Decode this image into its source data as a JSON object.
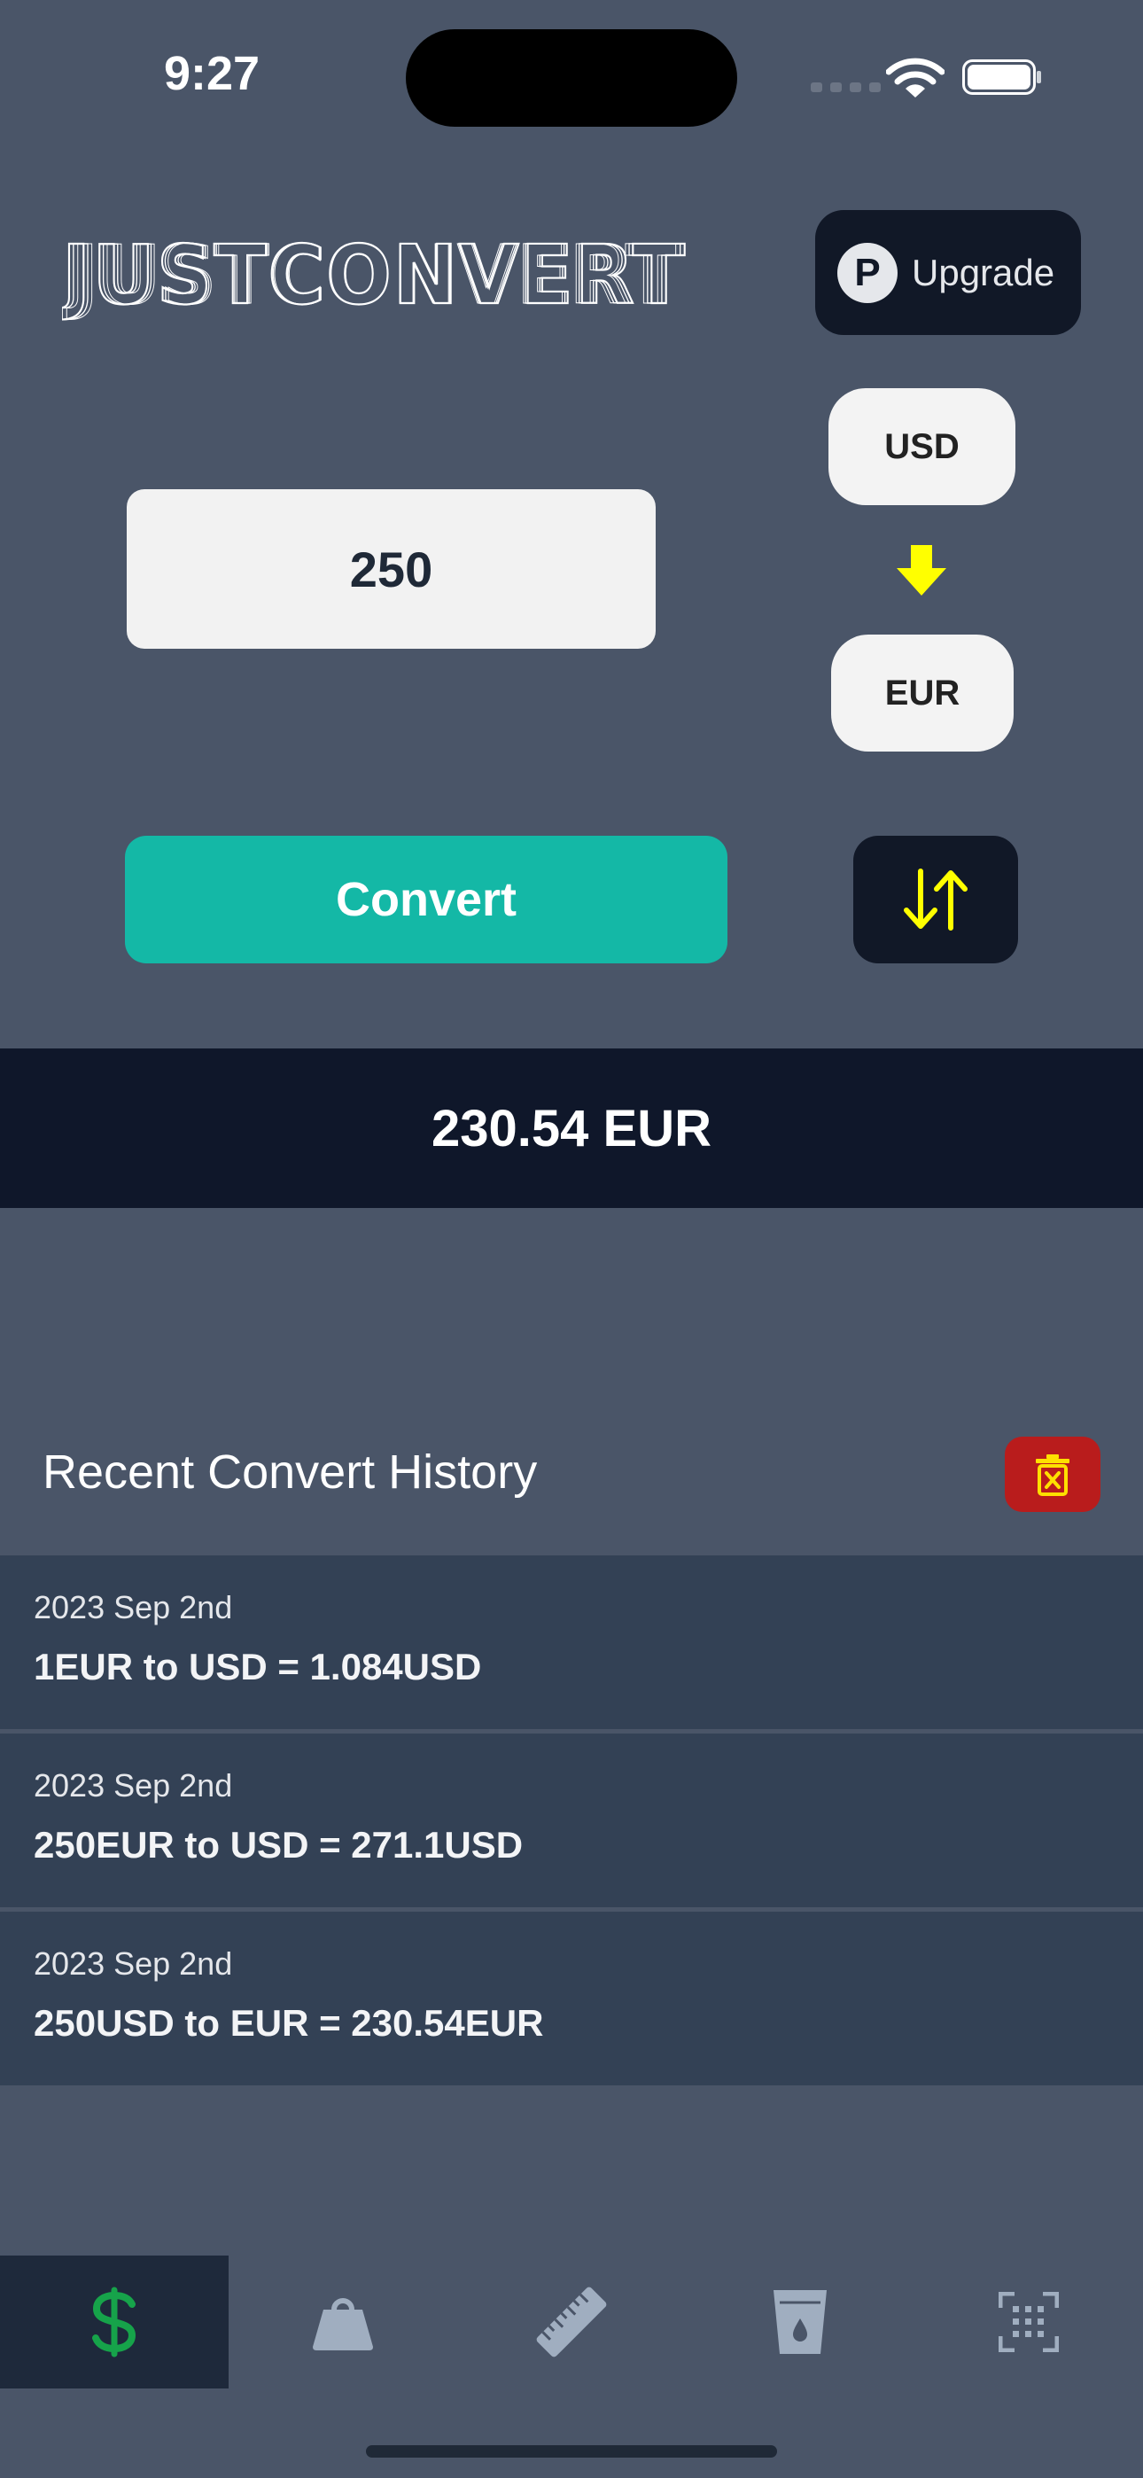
{
  "status_bar": {
    "time": "9:27"
  },
  "header": {
    "logo_text": "JUSTCONVERT",
    "upgrade": {
      "badge": "P",
      "label": "Upgrade"
    }
  },
  "converter": {
    "amount_value": "250",
    "from_currency": "USD",
    "to_currency": "EUR",
    "convert_label": "Convert",
    "result": "230.54 EUR"
  },
  "history": {
    "title": "Recent Convert History",
    "items": [
      {
        "date": "2023 Sep 2nd",
        "desc": "1EUR to USD = 1.084USD"
      },
      {
        "date": "2023 Sep 2nd",
        "desc": "250EUR to USD = 271.1USD"
      },
      {
        "date": "2023 Sep 2nd",
        "desc": "250USD to EUR = 230.54EUR"
      }
    ]
  },
  "tabs": [
    {
      "icon": "dollar-icon",
      "active": true
    },
    {
      "icon": "weight-icon",
      "active": false
    },
    {
      "icon": "ruler-icon",
      "active": false
    },
    {
      "icon": "cup-icon",
      "active": false
    },
    {
      "icon": "scan-icon",
      "active": false
    }
  ],
  "colors": {
    "background": "#4a5568",
    "dark": "#111827",
    "accent": "#14b8a6",
    "arrow": "#ffff00",
    "danger": "#b91c1c",
    "active_tab_icon": "#16a34a",
    "inactive_tab_icon": "#a0aec0"
  }
}
